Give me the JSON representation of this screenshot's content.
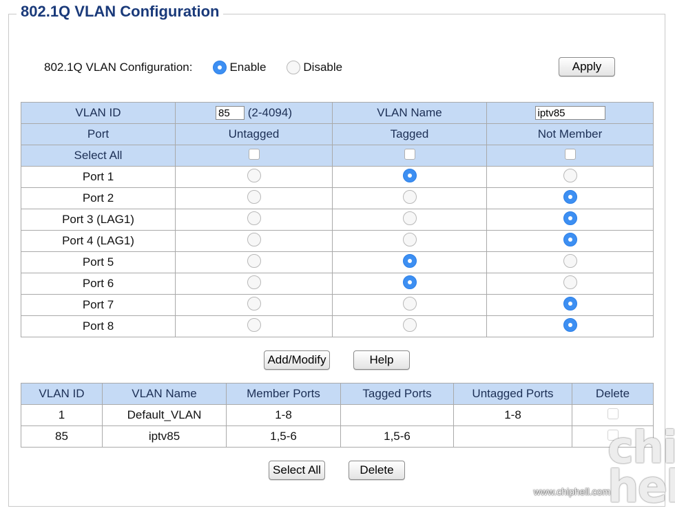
{
  "title": "802.1Q VLAN Configuration",
  "global": {
    "label": "802.1Q VLAN Configuration:",
    "enable": "Enable",
    "disable": "Disable",
    "selected": "Enable",
    "apply": "Apply"
  },
  "form": {
    "vlan_id_label": "VLAN ID",
    "vlan_id_value": "85",
    "vlan_id_range": "(2-4094)",
    "vlan_name_label": "VLAN Name",
    "vlan_name_value": "iptv85",
    "col_port": "Port",
    "col_untagged": "Untagged",
    "col_tagged": "Tagged",
    "col_not_member": "Not Member",
    "select_all": "Select All",
    "ports": [
      {
        "name": "Port 1",
        "mode": "tagged"
      },
      {
        "name": "Port 2",
        "mode": "not_member"
      },
      {
        "name": "Port 3 (LAG1)",
        "mode": "not_member"
      },
      {
        "name": "Port 4 (LAG1)",
        "mode": "not_member"
      },
      {
        "name": "Port 5",
        "mode": "tagged"
      },
      {
        "name": "Port 6",
        "mode": "tagged"
      },
      {
        "name": "Port 7",
        "mode": "not_member"
      },
      {
        "name": "Port 8",
        "mode": "not_member"
      }
    ],
    "add_modify": "Add/Modify",
    "help": "Help"
  },
  "list": {
    "headers": [
      "VLAN ID",
      "VLAN Name",
      "Member Ports",
      "Tagged Ports",
      "Untagged Ports",
      "Delete"
    ],
    "rows": [
      {
        "id": "1",
        "name": "Default_VLAN",
        "member": "1-8",
        "tagged": "",
        "untagged": "1-8"
      },
      {
        "id": "85",
        "name": "iptv85",
        "member": "1,5-6",
        "tagged": "1,5-6",
        "untagged": ""
      }
    ],
    "select_all": "Select All",
    "delete": "Delete"
  },
  "watermark": {
    "url": "www.chiphell.com",
    "logo": "chip hell"
  },
  "colors": {
    "header_bg": "#c5daf5",
    "radio_selected": "#3d8ff2",
    "title": "#1a3a7a"
  }
}
